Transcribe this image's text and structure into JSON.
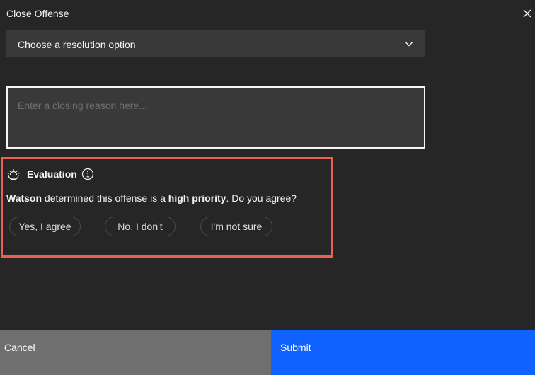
{
  "modal": {
    "title": "Close Offense"
  },
  "resolution": {
    "selected": "Choose a resolution option"
  },
  "reason": {
    "placeholder": "Enter a closing reason here..."
  },
  "evaluation": {
    "title": "Evaluation",
    "question_parts": {
      "subject": "Watson",
      "middle": " determined this offense is a ",
      "emphasis": "high priority",
      "end": ". Do you agree?"
    },
    "options": [
      "Yes, I agree",
      "No, I don't",
      "I'm not sure"
    ],
    "highlight_color": "#ed5e55"
  },
  "footer": {
    "cancel_label": "Cancel",
    "submit_label": "Submit"
  },
  "colors": {
    "background": "#262626",
    "field": "#393939",
    "cancel": "#6f6f6f",
    "submit": "#0f62fe"
  }
}
